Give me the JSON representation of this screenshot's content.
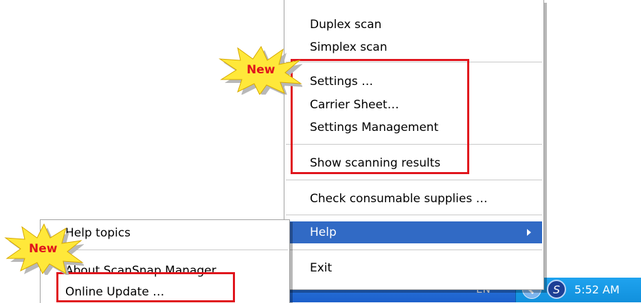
{
  "tray_menu": {
    "items": [
      {
        "label": "Duplex scan"
      },
      {
        "label": "Simplex scan"
      },
      {
        "label": "Settings …"
      },
      {
        "label": "Carrier Sheet…"
      },
      {
        "label": "Settings Management"
      },
      {
        "label": "Show scanning results"
      },
      {
        "label": "Check consumable supplies …"
      },
      {
        "label": "Help"
      },
      {
        "label": "Exit"
      }
    ]
  },
  "help_submenu": {
    "items": [
      {
        "label": "Help topics"
      },
      {
        "label": "About ScanSnap Manager …"
      },
      {
        "label": "Online Update …"
      }
    ]
  },
  "badges": {
    "new_main": "New",
    "new_help": "New"
  },
  "taskbar": {
    "language": "EN",
    "clock": "5:52 AM"
  },
  "colors": {
    "highlight_box": "#e0141c",
    "selected_item": "#316ac5",
    "taskbar": "#2563d6",
    "badge_fill": "#ffe83a"
  }
}
